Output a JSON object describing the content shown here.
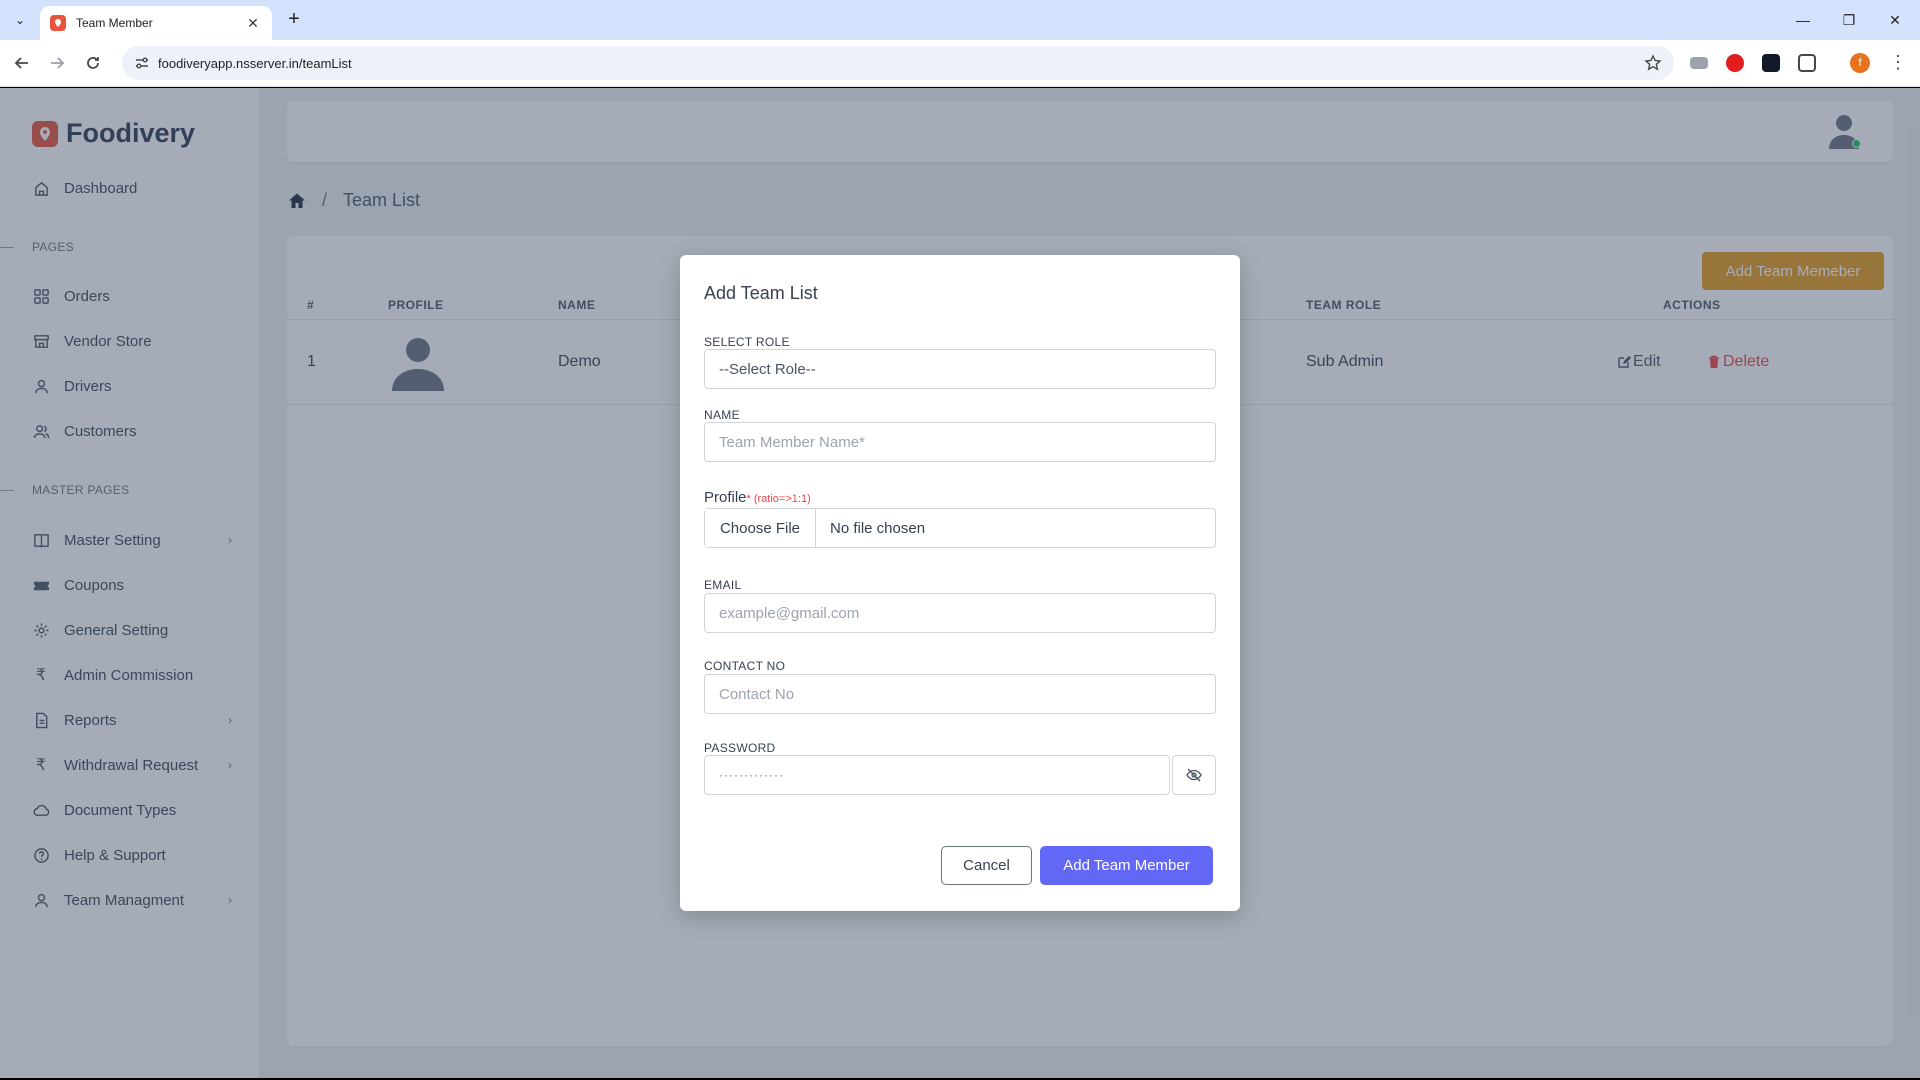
{
  "browser": {
    "tab_title": "Team Member",
    "url": "foodiveryapp.nsserver.in/teamList",
    "profile_initial": "f"
  },
  "brand": {
    "name": "Foodivery",
    "accent": "#e8533f"
  },
  "sidebar": {
    "dashboard": "Dashboard",
    "pages_label": "PAGES",
    "pages": [
      {
        "label": "Orders",
        "icon": "grid-icon"
      },
      {
        "label": "Vendor Store",
        "icon": "store-icon"
      },
      {
        "label": "Drivers",
        "icon": "user-icon"
      },
      {
        "label": "Customers",
        "icon": "users-icon"
      }
    ],
    "master_label": "MASTER PAGES",
    "master": [
      {
        "label": "Master Setting",
        "icon": "book-icon",
        "has_submenu": true
      },
      {
        "label": "Coupons",
        "icon": "ticket-icon",
        "has_submenu": false
      },
      {
        "label": "General Setting",
        "icon": "gear-icon",
        "has_submenu": false
      },
      {
        "label": "Admin Commission",
        "icon": "rupee-icon",
        "has_submenu": false
      },
      {
        "label": "Reports",
        "icon": "document-icon",
        "has_submenu": true
      },
      {
        "label": "Withdrawal Request",
        "icon": "rupee-icon",
        "has_submenu": true
      },
      {
        "label": "Document Types",
        "icon": "cloud-icon",
        "has_submenu": false
      },
      {
        "label": "Help & Support",
        "icon": "help-icon",
        "has_submenu": false
      },
      {
        "label": "Team Managment",
        "icon": "user-icon",
        "has_submenu": true
      }
    ]
  },
  "breadcrumb": {
    "current": "Team List"
  },
  "table": {
    "add_button": "Add Team Memeber",
    "headers": {
      "num": "#",
      "profile": "PROFILE",
      "name": "NAME",
      "role": "TEAM ROLE",
      "actions": "ACTIONS"
    },
    "rows": [
      {
        "num": "1",
        "name": "Demo",
        "role": "Sub Admin",
        "edit": "Edit",
        "delete": "Delete"
      }
    ]
  },
  "modal": {
    "title": "Add Team List",
    "role_label": "SELECT ROLE",
    "role_value": "--Select Role--",
    "name_label": "NAME",
    "name_placeholder": "Team Member Name*",
    "profile_label": "Profile",
    "profile_req": "* (ratio=>1:1)",
    "file_button": "Choose File",
    "file_status": "No file chosen",
    "email_label": "EMAIL",
    "email_placeholder": "example@gmail.com",
    "contact_label": "CONTACT NO",
    "contact_placeholder": "Contact No",
    "password_label": "PASSWORD",
    "password_value": "·············",
    "cancel": "Cancel",
    "submit": "Add Team Member",
    "primary_color": "#6367f5"
  }
}
